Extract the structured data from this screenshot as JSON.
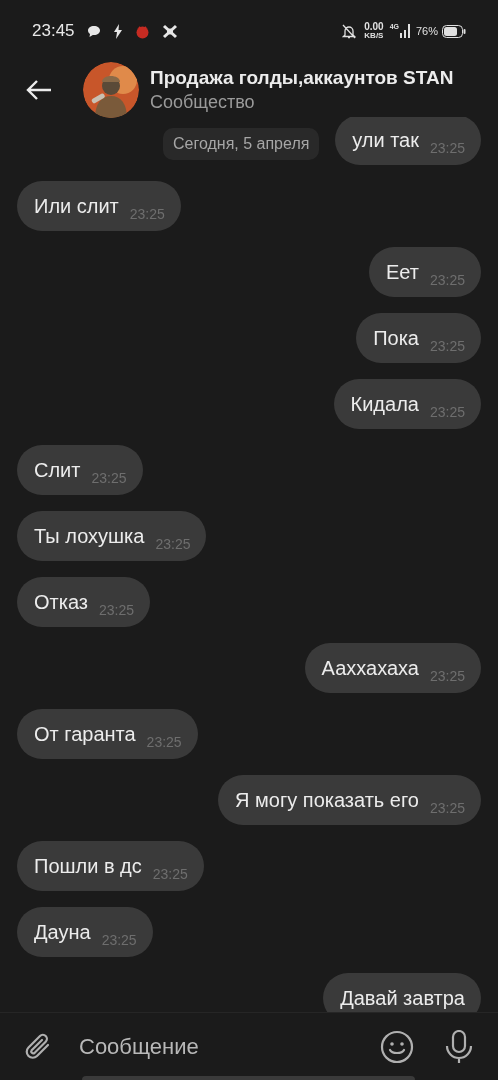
{
  "status_bar": {
    "time": "23:45",
    "speed": "0.00",
    "speed_unit": "KB/S",
    "network": "4G",
    "battery": "76%"
  },
  "header": {
    "title": "Продажа голды,аккаунтов STAN",
    "subtitle": "Сообщество"
  },
  "date_chip": "Сегодня, 5 апреля",
  "messages": [
    {
      "kind": "outgoing",
      "text": "ули так",
      "time": "23:25"
    },
    {
      "kind": "incoming",
      "text": "Или слит",
      "time": "23:25"
    },
    {
      "kind": "outgoing",
      "text": "Еет",
      "time": "23:25"
    },
    {
      "kind": "outgoing",
      "text": "Пока",
      "time": "23:25"
    },
    {
      "kind": "outgoing",
      "text": "Кидала",
      "time": "23:25"
    },
    {
      "kind": "incoming",
      "text": "Слит",
      "time": "23:25"
    },
    {
      "kind": "incoming",
      "text": "Ты лохушка",
      "time": "23:25"
    },
    {
      "kind": "incoming",
      "text": "Отказ",
      "time": "23:25"
    },
    {
      "kind": "outgoing",
      "text": "Ааххахаха",
      "time": "23:25"
    },
    {
      "kind": "incoming",
      "text": "От гаранта",
      "time": "23:25"
    },
    {
      "kind": "outgoing",
      "text": "Я могу показать его",
      "time": "23:25"
    },
    {
      "kind": "incoming",
      "text": "Пошли в дс",
      "time": "23:25"
    },
    {
      "kind": "incoming",
      "text": "Дауна",
      "time": "23:25"
    },
    {
      "kind": "outgoing",
      "text": "Давай завтра"
    }
  ],
  "composer": {
    "placeholder": "Сообщение"
  }
}
